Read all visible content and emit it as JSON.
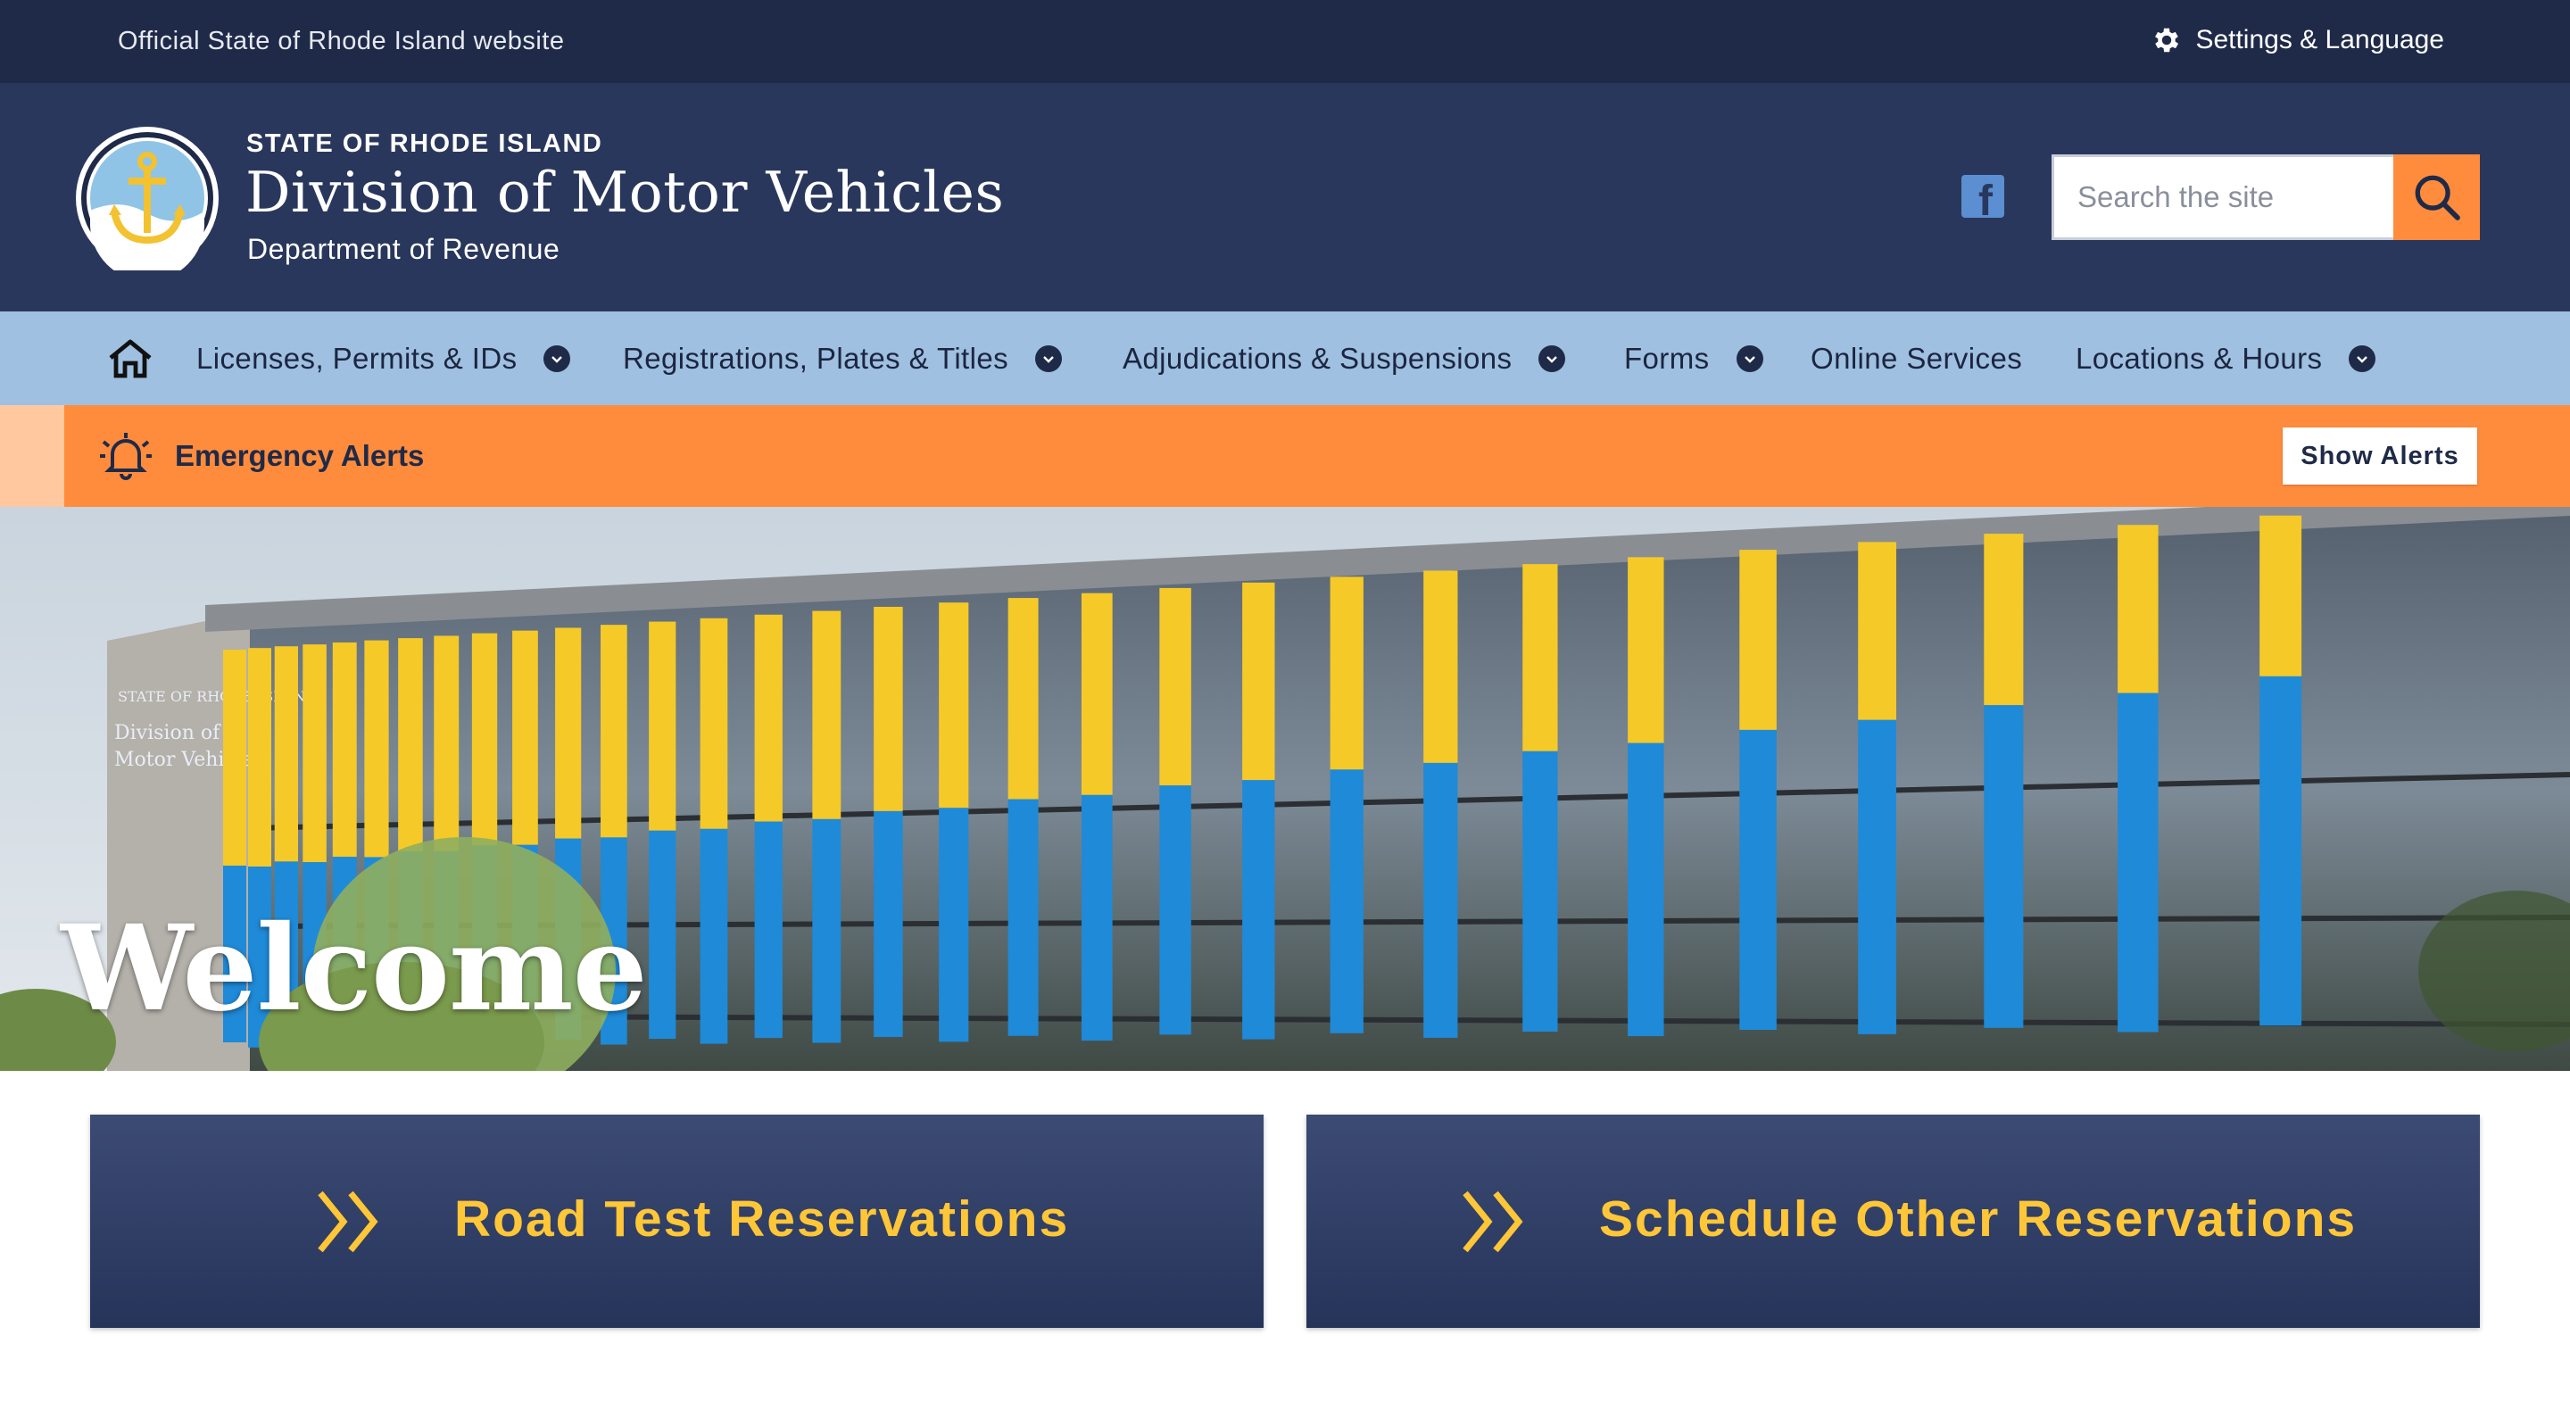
{
  "topbar": {
    "official_text": "Official State of Rhode Island website",
    "settings_label": "Settings & Language",
    "settings_icon": "gear-icon"
  },
  "header": {
    "eyebrow": "STATE OF RHODE ISLAND",
    "title": "Division of Motor Vehicles",
    "subtitle": "Department of Revenue",
    "seal_icon": "anchor-seal-icon",
    "social_icon": "facebook-icon",
    "search": {
      "placeholder": "Search the site",
      "value": ""
    },
    "search_button_icon": "search-icon"
  },
  "nav": {
    "home_icon": "home-icon",
    "items": [
      {
        "label": "Licenses, Permits & IDs",
        "has_dropdown": true
      },
      {
        "label": "Registrations, Plates & Titles",
        "has_dropdown": true
      },
      {
        "label": "Adjudications & Suspensions",
        "has_dropdown": true
      },
      {
        "label": "Forms",
        "has_dropdown": true
      },
      {
        "label": "Online Services",
        "has_dropdown": false
      },
      {
        "label": "Locations & Hours",
        "has_dropdown": true
      }
    ]
  },
  "alerts": {
    "icon": "bell-icon",
    "label": "Emergency Alerts",
    "button_label": "Show Alerts"
  },
  "hero": {
    "heading": "Welcome",
    "sign_lines": [
      "STATE OF RHODE ISLAND",
      "Division of",
      "Motor Vehicles"
    ]
  },
  "cta": [
    {
      "label": "Road Test Reservations",
      "icon": "double-chevron-right-icon"
    },
    {
      "label": "Schedule Other Reservations",
      "icon": "double-chevron-right-icon"
    }
  ],
  "colors": {
    "navy": "#1f2a48",
    "header_navy": "#2a375c",
    "nav_blue": "#9fc0e0",
    "alert_orange": "#ff8c3d",
    "accent_yellow": "#ffc637"
  }
}
